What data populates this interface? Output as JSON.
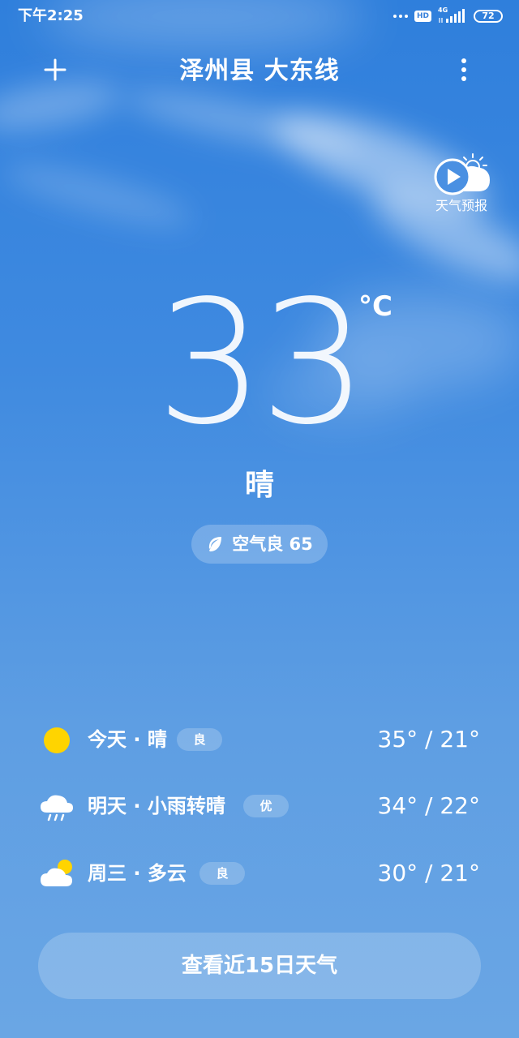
{
  "status_bar": {
    "time": "下午2:25",
    "hd": "HD",
    "network": "4G",
    "battery": "72"
  },
  "header": {
    "location": "泽州县 大东线"
  },
  "forecast_video": {
    "label": "天气预报"
  },
  "current": {
    "temperature": "33",
    "unit": "°C",
    "condition": "晴",
    "air_quality": "空气良 65"
  },
  "forecast": [
    {
      "day": "今天 · 晴",
      "aqi": "良",
      "range": "35° / 21°",
      "icon": "sun-icon"
    },
    {
      "day": "明天 · 小雨转晴",
      "aqi": "优",
      "range": "34° / 22°",
      "icon": "rain-cloud-icon"
    },
    {
      "day": "周三 · 多云",
      "aqi": "良",
      "range": "30° / 21°",
      "icon": "partly-cloudy-icon"
    }
  ],
  "bottom_button": {
    "label": "查看近15日天气"
  },
  "colors": {
    "sky_top": "#2f7fdc",
    "sky_bottom": "#6aa6e4",
    "sun": "#ffd400"
  }
}
